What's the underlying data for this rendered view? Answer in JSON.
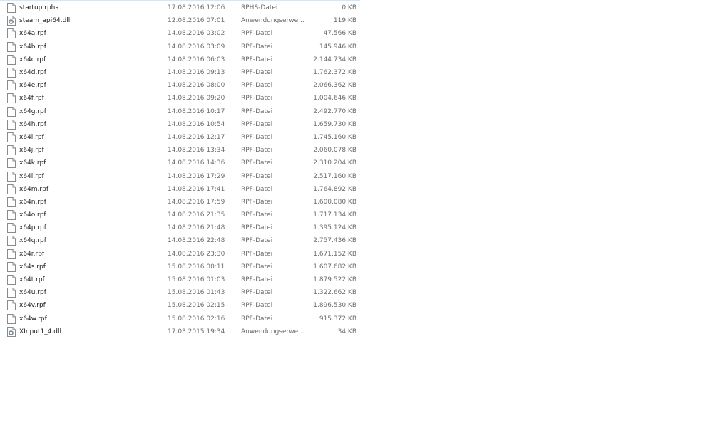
{
  "files": [
    {
      "name": "startup.rphs",
      "date": "17.08.2016 12:06",
      "type": "RPHS-Datei",
      "size": "0 KB",
      "icon": "document-icon"
    },
    {
      "name": "steam_api64.dll",
      "date": "12.08.2016 07:01",
      "type": "Anwendungserwe...",
      "size": "119 KB",
      "icon": "dll-gear-icon"
    },
    {
      "name": "x64a.rpf",
      "date": "14.08.2016 03:02",
      "type": "RPF-Datei",
      "size": "47.566 KB",
      "icon": "document-icon"
    },
    {
      "name": "x64b.rpf",
      "date": "14.08.2016 03:09",
      "type": "RPF-Datei",
      "size": "145.946 KB",
      "icon": "document-icon"
    },
    {
      "name": "x64c.rpf",
      "date": "14.08.2016 06:03",
      "type": "RPF-Datei",
      "size": "2.144.734 KB",
      "icon": "document-icon"
    },
    {
      "name": "x64d.rpf",
      "date": "14.08.2016 09:13",
      "type": "RPF-Datei",
      "size": "1.762.372 KB",
      "icon": "document-icon"
    },
    {
      "name": "x64e.rpf",
      "date": "14.08.2016 08:00",
      "type": "RPF-Datei",
      "size": "2.066.362 KB",
      "icon": "document-icon"
    },
    {
      "name": "x64f.rpf",
      "date": "14.08.2016 09:20",
      "type": "RPF-Datei",
      "size": "1.004.646 KB",
      "icon": "document-icon"
    },
    {
      "name": "x64g.rpf",
      "date": "14.08.2016 10:17",
      "type": "RPF-Datei",
      "size": "2.492.770 KB",
      "icon": "document-icon"
    },
    {
      "name": "x64h.rpf",
      "date": "14.08.2016 10:54",
      "type": "RPF-Datei",
      "size": "1.659.730 KB",
      "icon": "document-icon"
    },
    {
      "name": "x64i.rpf",
      "date": "14.08.2016 12:17",
      "type": "RPF-Datei",
      "size": "1.745.160 KB",
      "icon": "document-icon"
    },
    {
      "name": "x64j.rpf",
      "date": "14.08.2016 13:34",
      "type": "RPF-Datei",
      "size": "2.060.078 KB",
      "icon": "document-icon"
    },
    {
      "name": "x64k.rpf",
      "date": "14.08.2016 14:36",
      "type": "RPF-Datei",
      "size": "2.310.204 KB",
      "icon": "document-icon"
    },
    {
      "name": "x64l.rpf",
      "date": "14.08.2016 17:29",
      "type": "RPF-Datei",
      "size": "2.517.160 KB",
      "icon": "document-icon"
    },
    {
      "name": "x64m.rpf",
      "date": "14.08.2016 17:41",
      "type": "RPF-Datei",
      "size": "1.764.892 KB",
      "icon": "document-icon"
    },
    {
      "name": "x64n.rpf",
      "date": "14.08.2016 17:59",
      "type": "RPF-Datei",
      "size": "1.600.080 KB",
      "icon": "document-icon"
    },
    {
      "name": "x64o.rpf",
      "date": "14.08.2016 21:35",
      "type": "RPF-Datei",
      "size": "1.717.134 KB",
      "icon": "document-icon"
    },
    {
      "name": "x64p.rpf",
      "date": "14.08.2016 21:48",
      "type": "RPF-Datei",
      "size": "1.395.124 KB",
      "icon": "document-icon"
    },
    {
      "name": "x64q.rpf",
      "date": "14.08.2016 22:48",
      "type": "RPF-Datei",
      "size": "2.757.436 KB",
      "icon": "document-icon"
    },
    {
      "name": "x64r.rpf",
      "date": "14.08.2016 23:30",
      "type": "RPF-Datei",
      "size": "1.671.152 KB",
      "icon": "document-icon"
    },
    {
      "name": "x64s.rpf",
      "date": "15.08.2016 00:11",
      "type": "RPF-Datei",
      "size": "1.607.682 KB",
      "icon": "document-icon"
    },
    {
      "name": "x64t.rpf",
      "date": "15.08.2016 01:03",
      "type": "RPF-Datei",
      "size": "1.879.522 KB",
      "icon": "document-icon"
    },
    {
      "name": "x64u.rpf",
      "date": "15.08.2016 01:43",
      "type": "RPF-Datei",
      "size": "1.322.662 KB",
      "icon": "document-icon"
    },
    {
      "name": "x64v.rpf",
      "date": "15.08.2016 02:15",
      "type": "RPF-Datei",
      "size": "1.896.530 KB",
      "icon": "document-icon"
    },
    {
      "name": "x64w.rpf",
      "date": "15.08.2016 02:16",
      "type": "RPF-Datei",
      "size": "915.372 KB",
      "icon": "document-icon"
    },
    {
      "name": "XInput1_4.dll",
      "date": "17.03.2015 19:34",
      "type": "Anwendungserwe...",
      "size": "34 KB",
      "icon": "dll-gear-icon"
    }
  ]
}
